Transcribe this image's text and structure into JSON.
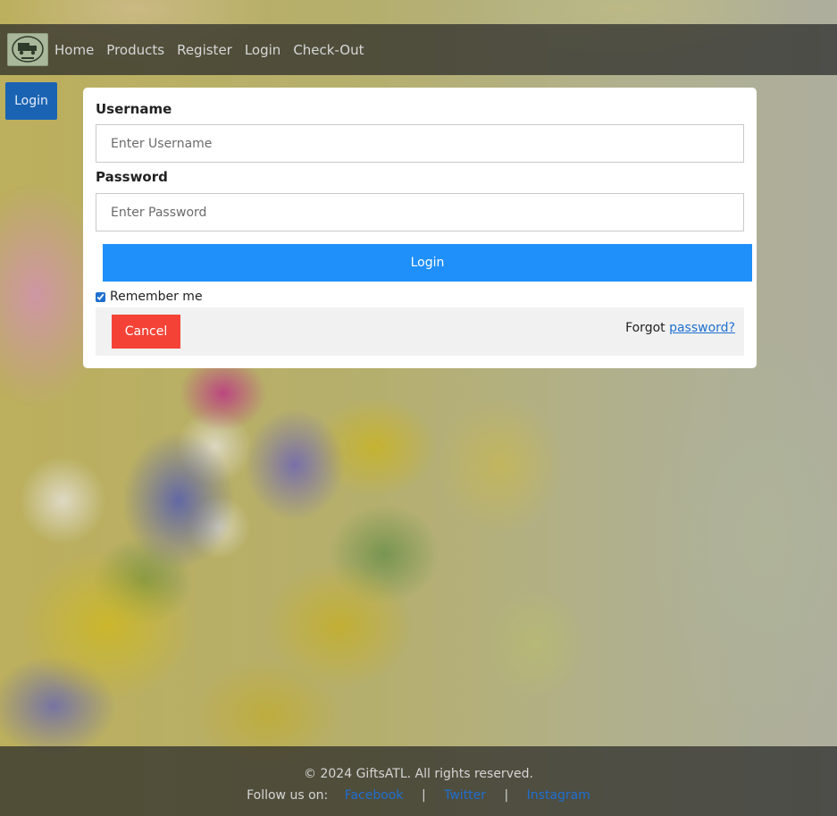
{
  "nav": {
    "logo_alt": "GiftsATL logo",
    "links": [
      "Home",
      "Products",
      "Register",
      "Login",
      "Check-Out"
    ]
  },
  "side_button": {
    "label": "Login"
  },
  "login_form": {
    "username_label": "Username",
    "username_placeholder": "Enter Username",
    "username_value": "",
    "password_label": "Password",
    "password_placeholder": "Enter Password",
    "password_value": "",
    "submit_label": "Login",
    "remember_label": "Remember me",
    "remember_checked": true,
    "cancel_label": "Cancel",
    "forgot_prefix": "Forgot",
    "forgot_link": "password?"
  },
  "footer": {
    "copyright": "© 2024 GiftsATL. All rights reserved.",
    "follow_label": "Follow us on:",
    "separator": "|",
    "social_links": [
      "Facebook",
      "Twitter",
      "Instagram"
    ]
  },
  "colors": {
    "primary": "#1f8ff9",
    "side_button": "#1a63b3",
    "cancel": "#f44336",
    "link": "#1f6fd0"
  }
}
